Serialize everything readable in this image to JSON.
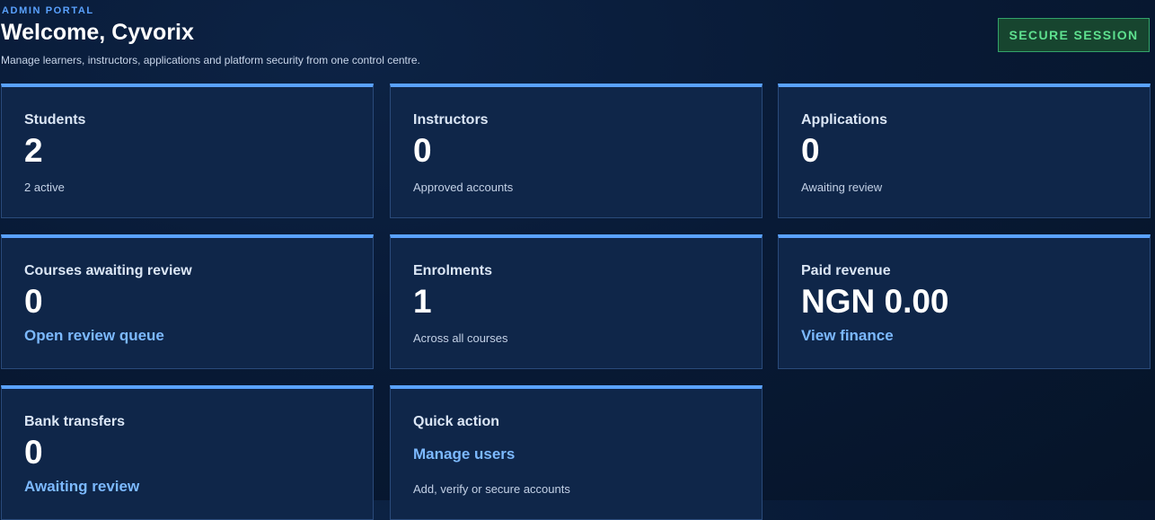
{
  "header": {
    "eyebrow": "ADMIN PORTAL",
    "title": "Welcome, Cyvorix",
    "subtitle": "Manage learners, instructors, applications and platform security from one control centre.",
    "badge": "SECURE SESSION"
  },
  "cards": {
    "students": {
      "label": "Students",
      "value": "2",
      "note": "2 active"
    },
    "instructors": {
      "label": "Instructors",
      "value": "0",
      "note": "Approved accounts"
    },
    "applications": {
      "label": "Applications",
      "value": "0",
      "note": "Awaiting review"
    },
    "courses": {
      "label": "Courses awaiting review",
      "value": "0",
      "link": "Open review queue"
    },
    "enrolments": {
      "label": "Enrolments",
      "value": "1",
      "note": "Across all courses"
    },
    "revenue": {
      "label": "Paid revenue",
      "value": "NGN 0.00",
      "link": "View finance"
    },
    "bank": {
      "label": "Bank transfers",
      "value": "0",
      "link": "Awaiting review"
    },
    "quick": {
      "label": "Quick action",
      "link": "Manage users",
      "note": "Add, verify or secure accounts"
    }
  },
  "colors": {
    "accent": "#5aa2ff",
    "link": "#7cb9ff",
    "secure_green": "#5ee08f",
    "card_bg": "#0f2649"
  }
}
